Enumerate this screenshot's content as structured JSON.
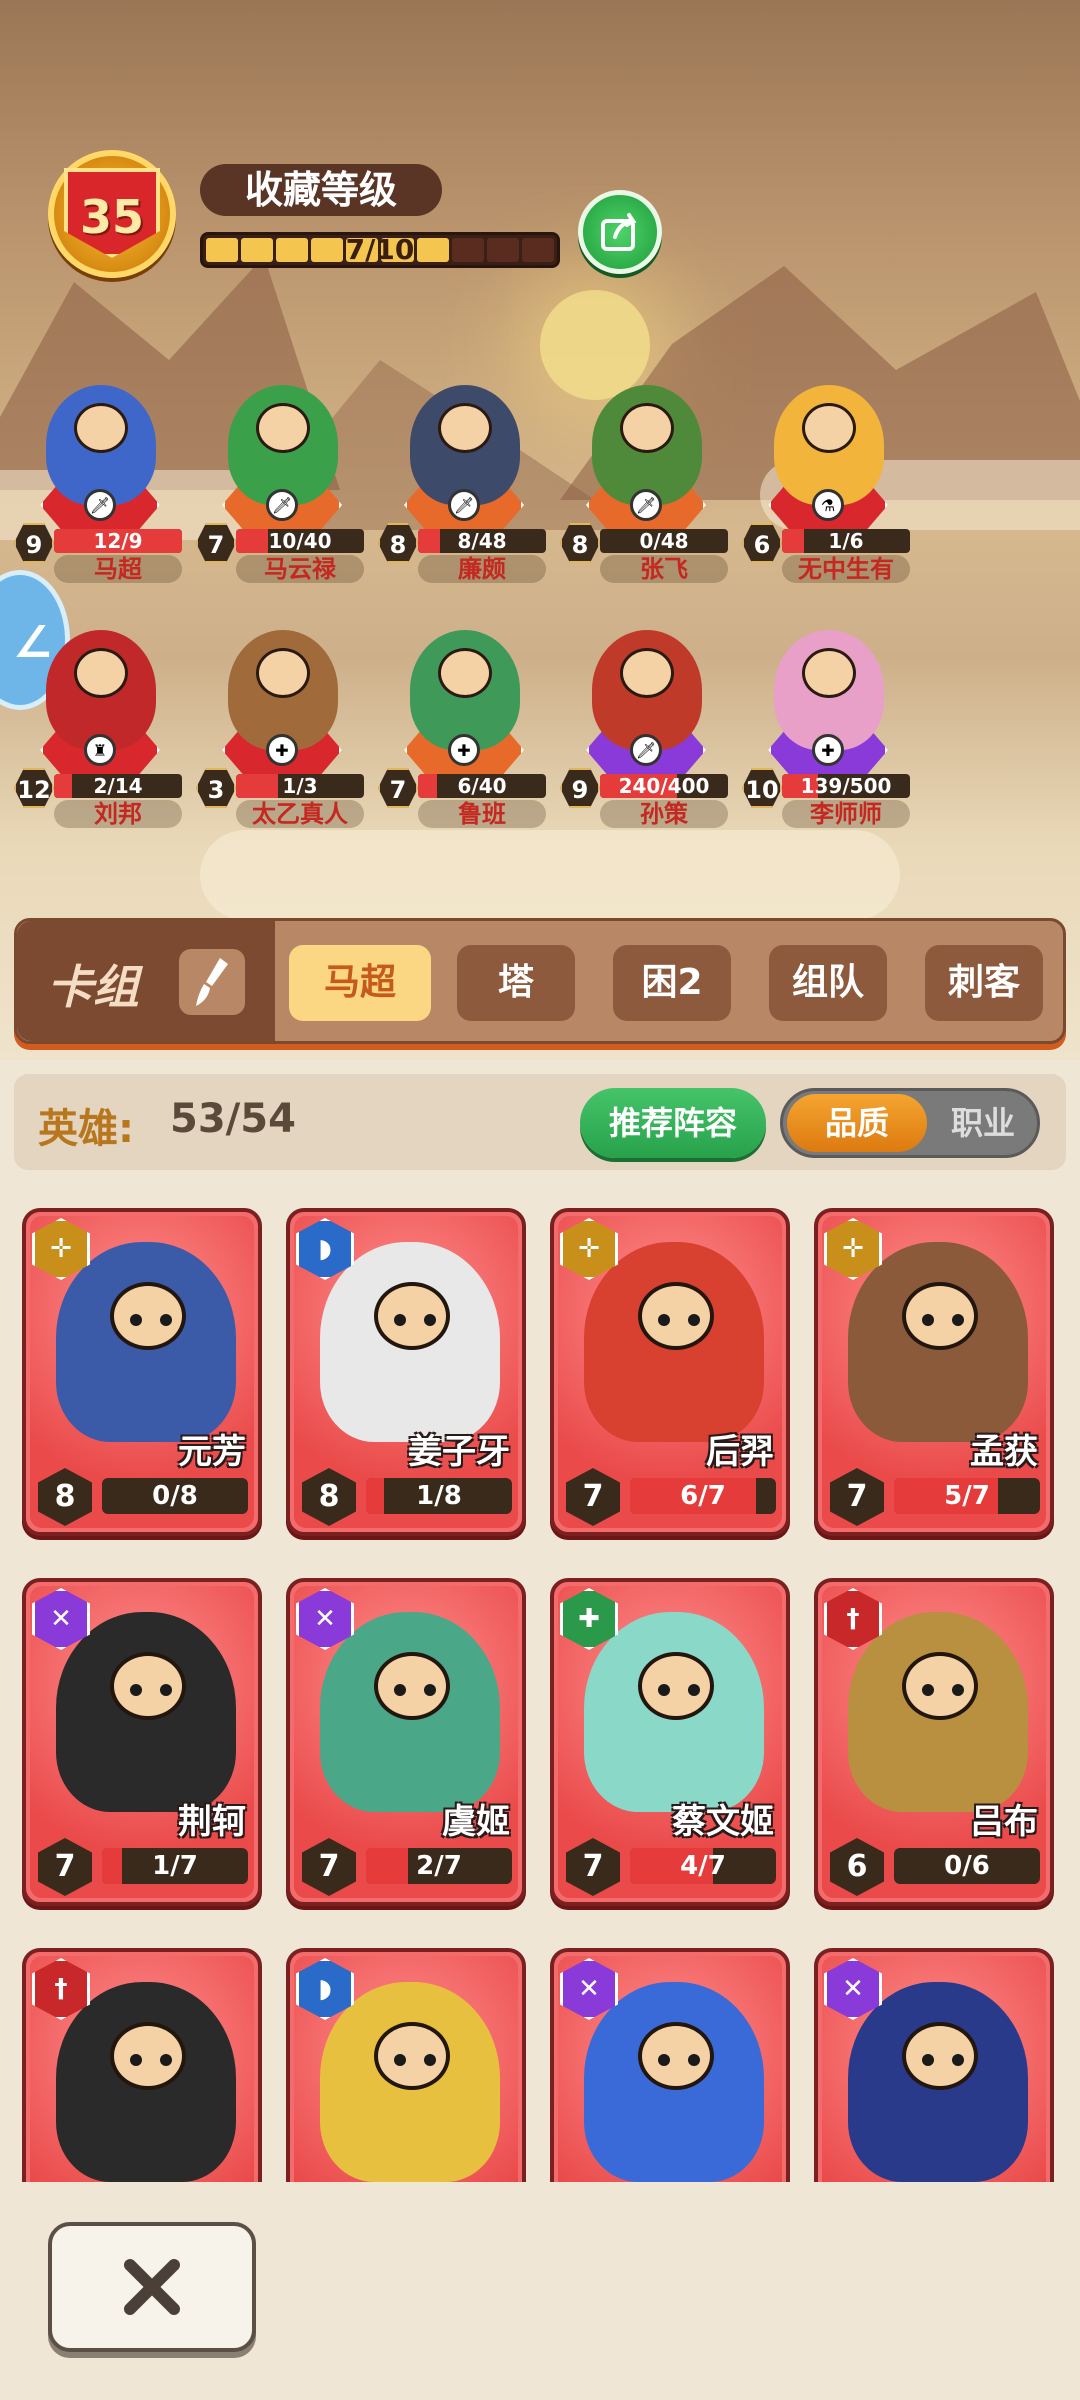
{
  "header": {
    "level": "35",
    "title": "收藏等级",
    "progress_text": "7/10",
    "progress": 0.7
  },
  "side_tab_glyph": "∠",
  "heroes": [
    {
      "level": "9",
      "progress": "12/9",
      "name": "马超",
      "fill": 1.0,
      "pad": "#d8282e",
      "cls": "sword-icon",
      "coat": "#3f67c9"
    },
    {
      "level": "7",
      "progress": "10/40",
      "name": "马云禄",
      "fill": 0.25,
      "pad": "#e86a2a",
      "cls": "sword-icon",
      "coat": "#3ba04a"
    },
    {
      "level": "8",
      "progress": "8/48",
      "name": "廉颇",
      "fill": 0.17,
      "pad": "#e86a2a",
      "cls": "sword-icon",
      "coat": "#3e4a6a"
    },
    {
      "level": "8",
      "progress": "0/48",
      "name": "张飞",
      "fill": 0.0,
      "pad": "#e86a2a",
      "cls": "sword-icon",
      "coat": "#4f8a3a"
    },
    {
      "level": "6",
      "progress": "1/6",
      "name": "无中生有",
      "fill": 0.17,
      "pad": "#d8282e",
      "cls": "potion-icon",
      "coat": "#f2b43a"
    },
    {
      "level": "12",
      "progress": "2/14",
      "name": "刘邦",
      "fill": 0.14,
      "pad": "#d8282e",
      "cls": "hat-icon",
      "coat": "#c0282a"
    },
    {
      "level": "3",
      "progress": "1/3",
      "name": "太乙真人",
      "fill": 0.33,
      "pad": "#d8282e",
      "cls": "heal-icon",
      "coat": "#a06a3a"
    },
    {
      "level": "7",
      "progress": "6/40",
      "name": "鲁班",
      "fill": 0.15,
      "pad": "#e86a2a",
      "cls": "heal-icon",
      "coat": "#3f9a5a"
    },
    {
      "level": "9",
      "progress": "240/400",
      "name": "孙策",
      "fill": 0.6,
      "pad": "#8a3ad8",
      "cls": "sword-icon",
      "coat": "#c03a2a"
    },
    {
      "level": "10",
      "progress": "139/500",
      "name": "李师师",
      "fill": 0.28,
      "pad": "#8a3ad8",
      "cls": "heal-icon",
      "coat": "#e8a0c8"
    }
  ],
  "deck": {
    "title": "卡组",
    "tabs": [
      "马超",
      "塔",
      "困2",
      "组队",
      "刺客"
    ]
  },
  "hero_bar": {
    "label": "英雄:",
    "count": "53/54",
    "recommend": "推荐阵容",
    "toggle_a": "品质",
    "toggle_b": "职业"
  },
  "cards": [
    {
      "name": "元芳",
      "level": "8",
      "progress": "0/8",
      "fill": 0.0,
      "type": "crossbow-icon",
      "type_color": "#c8901a",
      "skin": "#3b5aa8"
    },
    {
      "name": "姜子牙",
      "level": "8",
      "progress": "1/8",
      "fill": 0.125,
      "type": "helmet-icon",
      "type_color": "#2a6ac8",
      "skin": "#e8e8e8"
    },
    {
      "name": "后羿",
      "level": "7",
      "progress": "6/7",
      "fill": 0.86,
      "type": "crossbow-icon",
      "type_color": "#c8901a",
      "skin": "#d84030"
    },
    {
      "name": "孟获",
      "level": "7",
      "progress": "5/7",
      "fill": 0.71,
      "type": "crossbow-icon",
      "type_color": "#c8901a",
      "skin": "#8a5a3a"
    },
    {
      "name": "荆轲",
      "level": "7",
      "progress": "1/7",
      "fill": 0.14,
      "type": "swords-icon",
      "type_color": "#8a3ad8",
      "skin": "#2a2a2a"
    },
    {
      "name": "虞姬",
      "level": "7",
      "progress": "2/7",
      "fill": 0.29,
      "type": "swords-icon",
      "type_color": "#8a3ad8",
      "skin": "#4aa888"
    },
    {
      "name": "蔡文姬",
      "level": "7",
      "progress": "4/7",
      "fill": 0.57,
      "type": "heal-icon",
      "type_color": "#2a9a4a",
      "skin": "#8ad8c8"
    },
    {
      "name": "吕布",
      "level": "6",
      "progress": "0/6",
      "fill": 0.0,
      "type": "sword-icon",
      "type_color": "#c8282a",
      "skin": "#b89040"
    },
    {
      "name": "",
      "level": "",
      "progress": "",
      "fill": 0.0,
      "type": "sword-icon",
      "type_color": "#c8282a",
      "skin": "#2a2a2a"
    },
    {
      "name": "",
      "level": "",
      "progress": "",
      "fill": 0.0,
      "type": "helmet-icon",
      "type_color": "#2a6ac8",
      "skin": "#e8c040"
    },
    {
      "name": "",
      "level": "",
      "progress": "",
      "fill": 0.0,
      "type": "swords-icon",
      "type_color": "#8a3ad8",
      "skin": "#3a6ad8"
    },
    {
      "name": "",
      "level": "",
      "progress": "",
      "fill": 0.0,
      "type": "swords-icon",
      "type_color": "#8a3ad8",
      "skin": "#2a3a8a"
    }
  ],
  "close_icon": "close-icon"
}
